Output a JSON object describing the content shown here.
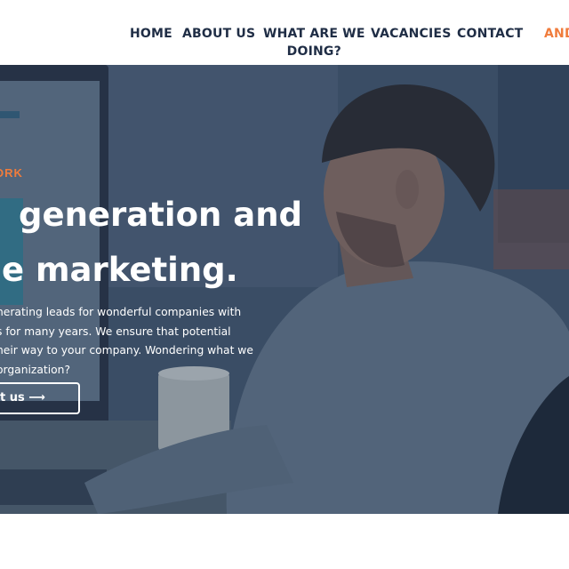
{
  "nav": {
    "items": [
      {
        "label": "HOME"
      },
      {
        "label": "ABOUT US"
      },
      {
        "label_line1": "WHAT ARE WE",
        "label_line2": "DOING?"
      },
      {
        "label": "VACANCIES"
      },
      {
        "label": "CONTACT"
      },
      {
        "label": "AND"
      }
    ],
    "accent_color": "#f07c3c",
    "text_color": "#1f2d45"
  },
  "hero": {
    "eyebrow": "ORK",
    "title_line1": "generation and",
    "title_line2": "e marketing.",
    "text_lines": [
      "nerating leads for wonderful companies with",
      "s for many years. We ensure that potential",
      "heir way to your company. Wondering what we",
      "organization?"
    ],
    "cta_label": "t us ⟶",
    "overlay_color": "#1c304e"
  }
}
